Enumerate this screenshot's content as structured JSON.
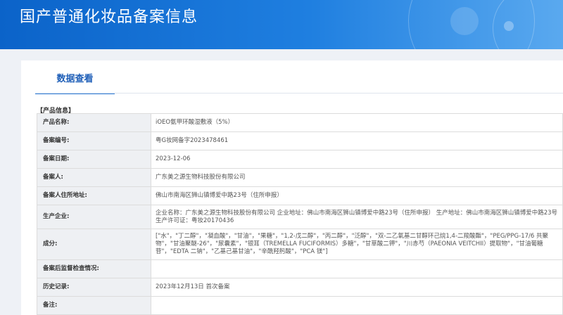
{
  "header": {
    "title": "国产普通化妆品备案信息"
  },
  "tabs": [
    {
      "label": "数据查看",
      "active": true
    }
  ],
  "section": {
    "title": "【产品信息】"
  },
  "fields": {
    "product_name": {
      "label": "产品名称:",
      "value": "iOEO氨甲环酸湿敷液（5%）"
    },
    "record_number": {
      "label": "备案编号:",
      "value": "粤G妆网备字2023478461"
    },
    "record_date": {
      "label": "备案日期:",
      "value": "2023-12-06"
    },
    "filer": {
      "label": "备案人:",
      "value": "广东美之源生物科技股份有限公司"
    },
    "filer_address": {
      "label": "备案人住所地址:",
      "value": "佛山市南海区狮山镇博爱中路23号（住所申报）"
    },
    "manufacturer": {
      "label": "生产企业:",
      "value": "企业名称：广东美之源生物科技股份有限公司 企业地址：佛山市南海区狮山镇博爱中路23号（住所申报） 生产地址：佛山市南海区狮山镇博爱中路23号 生产许可证：粤妆20170436"
    },
    "ingredients": {
      "label": "成分:",
      "value": "[\"水\"，\"丁二醇\"，\"凝血酸\"，\"甘油\"，\"果糖\"，\"1,2-戊二醇\"，\"丙二醇\"，\"泛醇\"，\"双-二乙氧基二甘醇环己烷1,4-二羧酸酯\"，\"PEG/PPG-17/6 共聚物\"，\"甘油聚醚-26\"，\"尿囊素\"，\"银耳（TREMELLA FUCIFORMIS）多糖\"，\"甘草酸二钾\"，\"川赤芍（PAEONIA VEITCHII）提取物\"，\"甘油葡糖苷\"，\"EDTA 二钠\"，\"乙基己基甘油\"，\"辛酰羟肟酸\"，\"PCA 镁\"]"
    },
    "post_inspection": {
      "label": "备案后监督检查情况:",
      "value": ""
    },
    "history": {
      "label": "历史记录:",
      "value": "2023年12月13日 首次备案"
    },
    "remarks": {
      "label": "备注:",
      "value": ""
    }
  }
}
